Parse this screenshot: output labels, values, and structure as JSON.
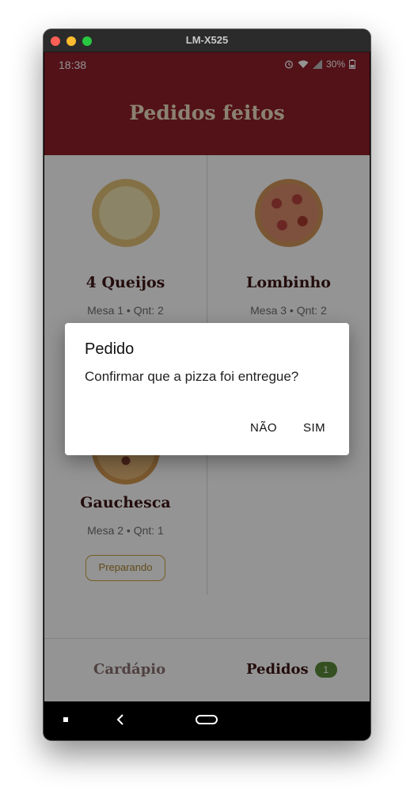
{
  "window": {
    "title": "LM-X525"
  },
  "status_bar": {
    "time": "18:38",
    "battery": "30%",
    "icons": [
      "alarm-icon",
      "wifi-icon",
      "signal-icon",
      "battery-icon"
    ]
  },
  "header": {
    "title": "Pedidos feitos"
  },
  "orders": [
    {
      "name": "4 Queijos",
      "meta": "Mesa 1 • Qnt: 2"
    },
    {
      "name": "Lombinho",
      "meta": "Mesa 3 • Qnt: 2"
    },
    {
      "name": "Gauchesca",
      "meta": "Mesa 2 • Qnt: 1",
      "status": "Preparando"
    }
  ],
  "bottom_nav": {
    "cardapio": "Cardápio",
    "pedidos": "Pedidos",
    "pedidos_badge": "1"
  },
  "dialog": {
    "title": "Pedido",
    "message": "Confirmar que a pizza foi entregue?",
    "cancel": "NÃO",
    "confirm": "SIM"
  },
  "colors": {
    "app_bar": "#8e1f2a",
    "title_text": "#efe0c3",
    "accent": "#c8a23a",
    "badge": "#5a8a3a"
  }
}
